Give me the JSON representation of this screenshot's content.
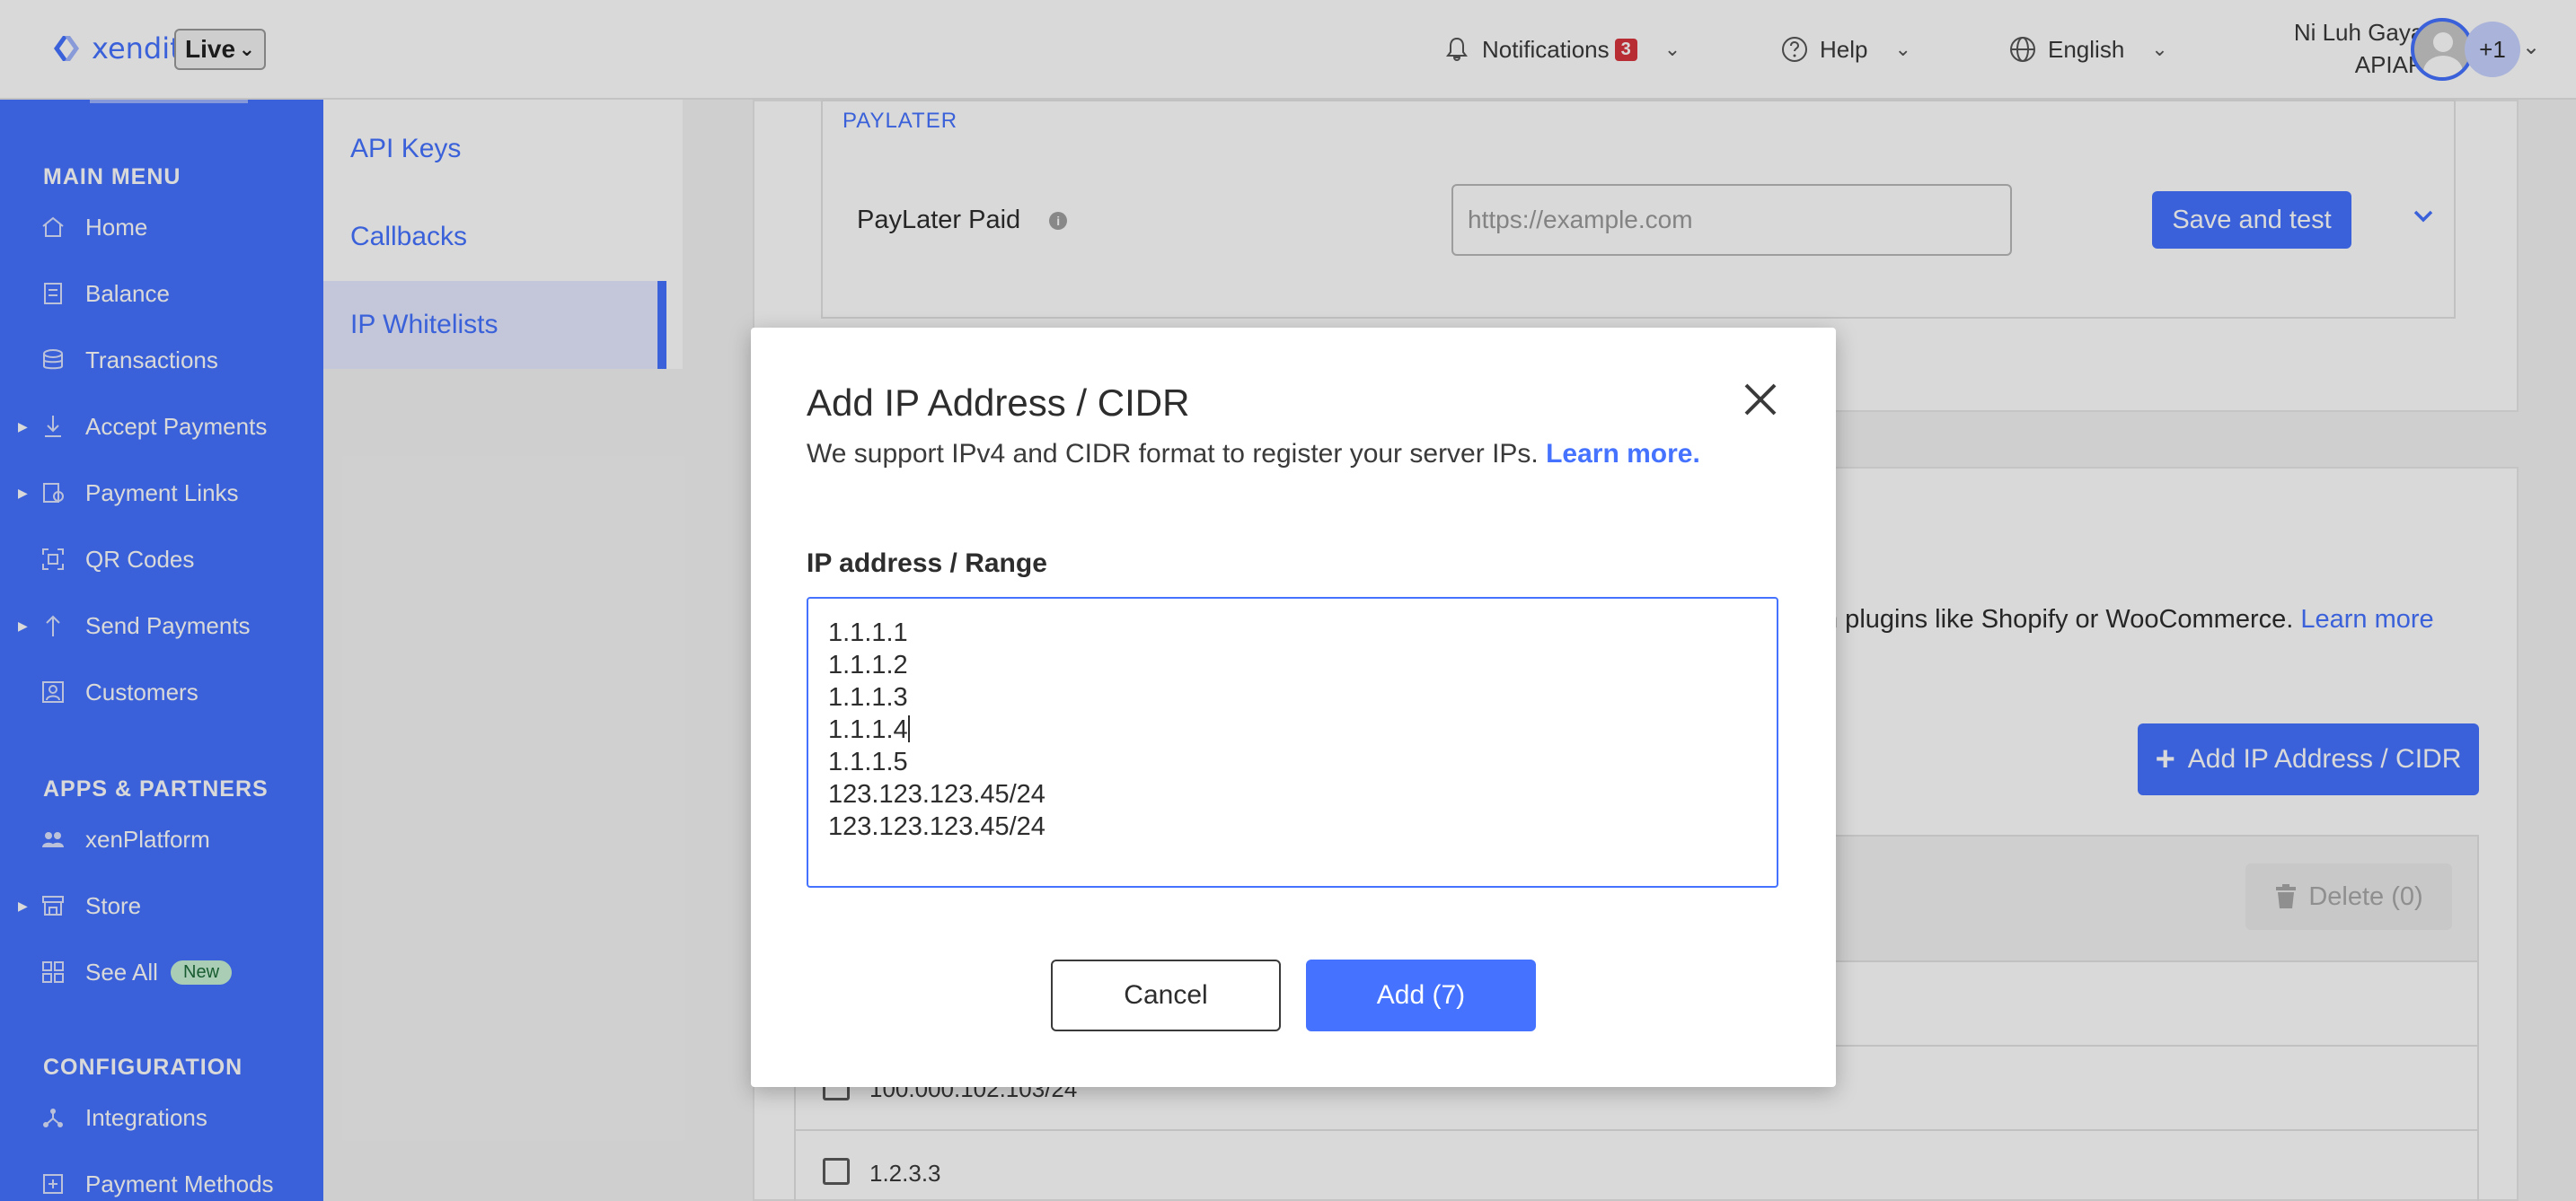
{
  "header": {
    "logo_text": "xendit",
    "environment": "Live",
    "notifications_label": "Notifications",
    "notifications_count": "3",
    "help_label": "Help",
    "language_label": "English",
    "user_name": "Ni Luh Gayatri",
    "user_org": "APIAPM",
    "extra_accounts": "+1"
  },
  "sidebar": {
    "main_menu_title": "MAIN MENU",
    "main_items": [
      {
        "label": "Home",
        "icon": "home-icon"
      },
      {
        "label": "Balance",
        "icon": "balance-icon"
      },
      {
        "label": "Transactions",
        "icon": "transactions-icon"
      },
      {
        "label": "Accept Payments",
        "icon": "accept-payments-icon"
      },
      {
        "label": "Payment Links",
        "icon": "payment-links-icon"
      },
      {
        "label": "QR Codes",
        "icon": "qr-code-icon"
      },
      {
        "label": "Send Payments",
        "icon": "send-payments-icon"
      },
      {
        "label": "Customers",
        "icon": "customers-icon"
      }
    ],
    "apps_title": "APPS & PARTNERS",
    "apps_items": [
      {
        "label": "xenPlatform",
        "icon": "xenplatform-icon"
      },
      {
        "label": "Store",
        "icon": "store-icon"
      },
      {
        "label": "See All",
        "icon": "see-all-icon",
        "badge": "New"
      }
    ],
    "config_title": "CONFIGURATION",
    "config_items": [
      {
        "label": "Integrations",
        "icon": "integrations-icon"
      },
      {
        "label": "Payment Methods",
        "icon": "payment-methods-icon"
      }
    ]
  },
  "subnav": {
    "items": [
      {
        "label": "API Keys"
      },
      {
        "label": "Callbacks"
      },
      {
        "label": "IP Whitelists"
      }
    ]
  },
  "callbacks": {
    "section_label": "PAYLATER",
    "row_label": "PayLater Paid",
    "url_placeholder": "https://example.com",
    "save_label": "Save and test"
  },
  "whitelist": {
    "description_visible": "n plugins like Shopify or WooCommerce.",
    "learn_more": "Learn more",
    "add_button_label": "Add IP Address / CIDR",
    "delete_label": "Delete (0)",
    "rows": [
      {
        "ip": ""
      },
      {
        "ip": "100.000.102.103/24"
      },
      {
        "ip": "1.2.3.3"
      }
    ]
  },
  "modal": {
    "title": "Add IP Address / CIDR",
    "subtitle": "We support IPv4 and CIDR format to register your server IPs.",
    "learn_more": "Learn more.",
    "field_label": "IP address / Range",
    "ip_lines": [
      "1.1.1.1",
      "1.1.1.2",
      "1.1.1.3",
      "1.1.1.4",
      "1.1.1.5",
      "123.123.123.45/24",
      "123.123.123.45/24"
    ],
    "cancel_label": "Cancel",
    "add_label": "Add (7)"
  },
  "colors": {
    "brand": "#4573ff",
    "badge_red": "#d9363e",
    "new_badge_bg": "#c7f2d5"
  }
}
